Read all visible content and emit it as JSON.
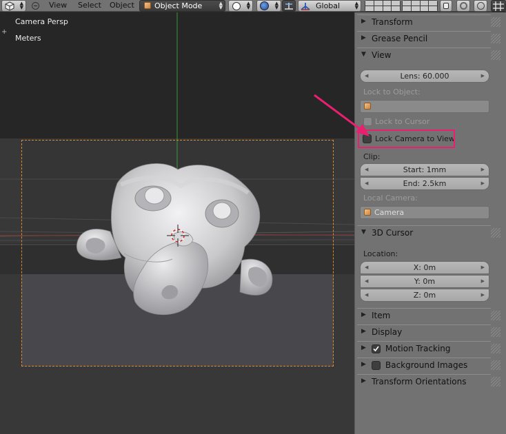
{
  "header": {
    "menus": [
      "View",
      "Select",
      "Object"
    ],
    "mode": "Object Mode",
    "orientation": "Global"
  },
  "viewport": {
    "view_name": "Camera Persp",
    "units": "Meters"
  },
  "panel": {
    "transform": "Transform",
    "grease_pencil": "Grease Pencil",
    "view": "View",
    "lens": "Lens: 60.000",
    "lock_to_object": "Lock to Object:",
    "lock_to_cursor": "Lock to Cursor",
    "lock_camera_to_view": "Lock Camera to View",
    "clip": "Clip:",
    "clip_start": "Start: 1mm",
    "clip_end": "End: 2.5km",
    "local_camera": "Local Camera:",
    "camera": "Camera",
    "cursor_3d": "3D Cursor",
    "location": "Location:",
    "x": "X: 0m",
    "y": "Y: 0m",
    "z": "Z: 0m",
    "item": "Item",
    "display": "Display",
    "motion_tracking": "Motion Tracking",
    "background_images": "Background Images",
    "transform_orientations": "Transform Orientations"
  },
  "state": {
    "lock_to_cursor_checked": false,
    "lock_camera_to_view_checked": false,
    "motion_tracking_checked": true,
    "background_images_checked": false
  },
  "colors": {
    "annotation": "#e8206f",
    "camera_frame": "#e38a2a",
    "y_axis": "#3a9a3a",
    "x_axis": "#a03030",
    "panel_bg": "#727272"
  }
}
